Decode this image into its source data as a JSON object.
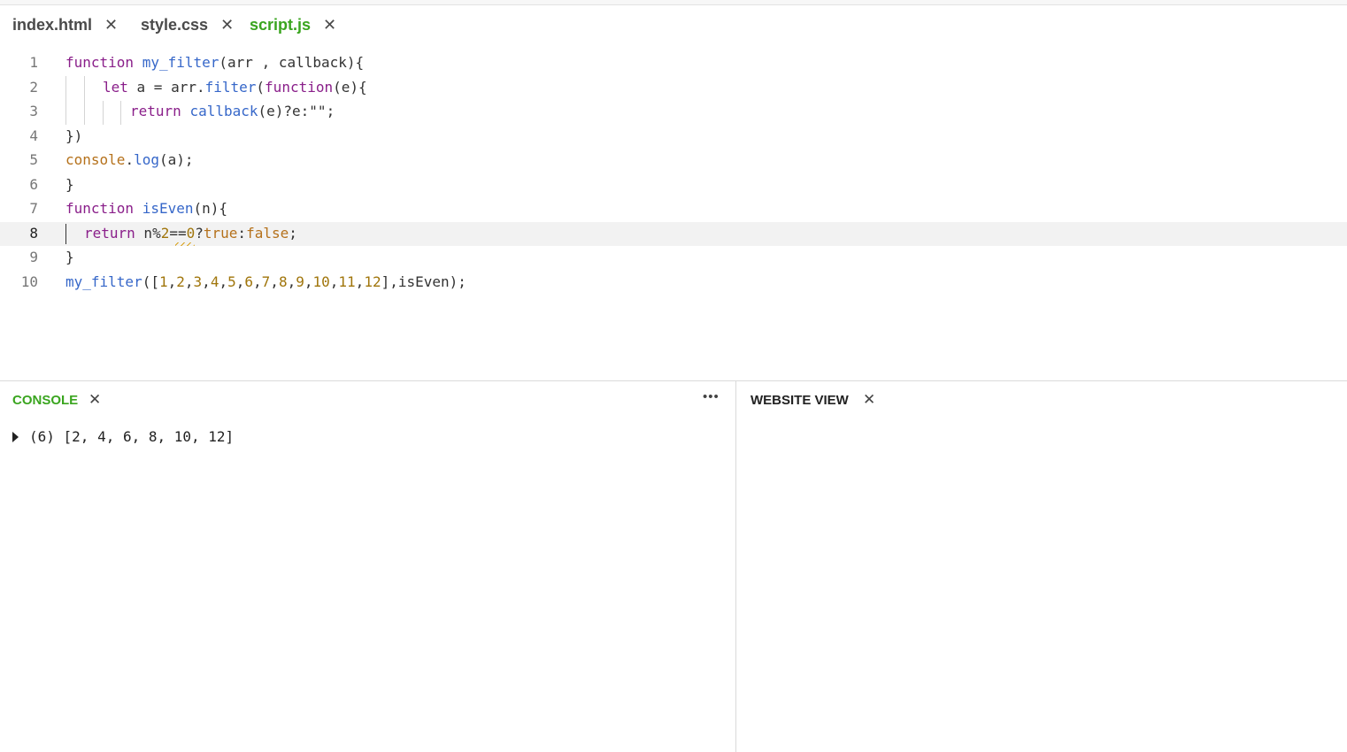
{
  "tabs": [
    {
      "label": "index.html",
      "active": false
    },
    {
      "label": "style.css",
      "active": false
    },
    {
      "label": "script.js",
      "active": true
    }
  ],
  "close_glyph": "✕",
  "editor": {
    "current_line": 8,
    "lines": [
      {
        "number": "1",
        "text": "function my_filter(arr , callback){"
      },
      {
        "number": "2",
        "text": "let a = arr.filter(function(e){"
      },
      {
        "number": "3",
        "text": "return callback(e)?e:\"\";"
      },
      {
        "number": "4",
        "text": "})"
      },
      {
        "number": "5",
        "text": "console.log(a);"
      },
      {
        "number": "6",
        "text": "}"
      },
      {
        "number": "7",
        "text": "function isEven(n){"
      },
      {
        "number": "8",
        "text": "return n%2==0?true:false;"
      },
      {
        "number": "9",
        "text": "}"
      },
      {
        "number": "10",
        "text": "my_filter([1,2,3,4,5,6,7,8,9,10,11,12],isEven);"
      }
    ]
  },
  "console": {
    "title": "CONSOLE",
    "more": "•••",
    "output": "(6) [2, 4, 6, 8, 10, 12]"
  },
  "website_view": {
    "title": "WEBSITE VIEW"
  },
  "colors": {
    "accent_green": "#3aa51f",
    "keyword": "#8a1f8a",
    "function": "#3667c9",
    "property": "#b5711b",
    "number": "#a0750b"
  }
}
